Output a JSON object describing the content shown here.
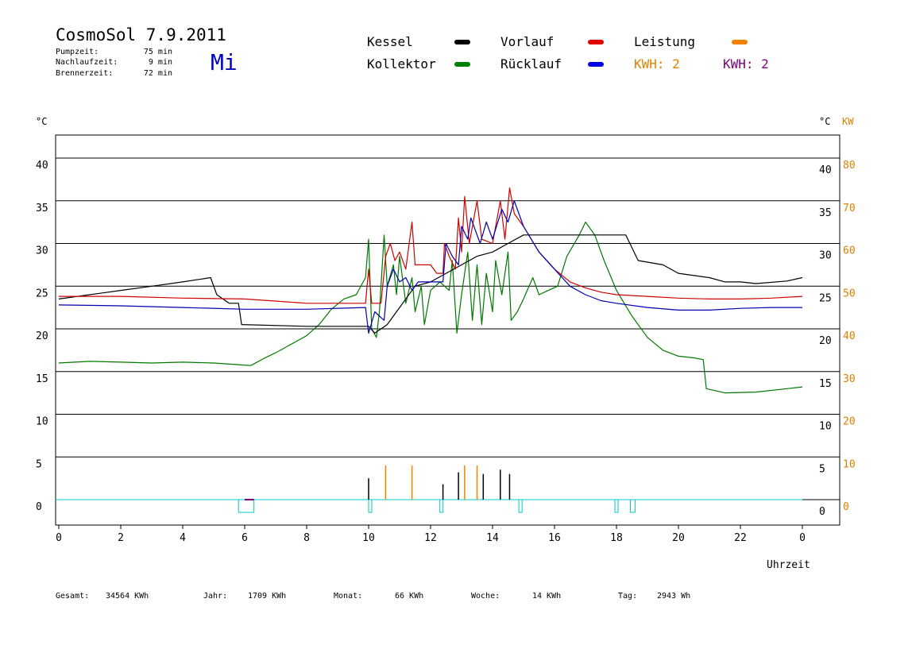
{
  "header": {
    "title": "CosmoSol 7.9.2011",
    "weekday": "Mi",
    "stats": [
      {
        "label": "Pumpzeit:",
        "value": "75 min"
      },
      {
        "label": "Nachlaufzeit:",
        "value": "9 min"
      },
      {
        "label": "Brennerzeit:",
        "value": "72 min"
      }
    ]
  },
  "legend": {
    "items": [
      {
        "label": "Kessel",
        "color": "#000000"
      },
      {
        "label": "Vorlauf",
        "color": "#e00000"
      },
      {
        "label": "Leistung",
        "color": "#f08000"
      },
      {
        "label": "Kollektor",
        "color": "#008000"
      },
      {
        "label": "Rücklauf",
        "color": "#0000e0"
      }
    ],
    "kwh_orange": "KWH: 2",
    "kwh_purple": "KWH: 2",
    "kwh_orange_color": "#e08000",
    "kwh_purple_color": "#800080"
  },
  "axes": {
    "left_unit": "°C",
    "right_unit": "°C",
    "right_unit2": "KW",
    "xlabel": "Uhrzeit"
  },
  "footer": [
    {
      "label": "Gesamt:",
      "value": "34564 KWh"
    },
    {
      "label": "Jahr:",
      "value": "1709 KWh"
    },
    {
      "label": "Monat:",
      "value": "66 KWh"
    },
    {
      "label": "Woche:",
      "value": "14 KWh"
    },
    {
      "label": "Tag:",
      "value": "2943 Wh"
    }
  ],
  "chart_data": {
    "type": "line",
    "xlim": [
      0,
      24
    ],
    "ylim": [
      -3,
      43
    ],
    "y2lim": [
      -6,
      86
    ],
    "grid": true,
    "x_ticks": [
      {
        "v": 0,
        "label": "0"
      },
      {
        "v": 2,
        "label": "2"
      },
      {
        "v": 4,
        "label": "4"
      },
      {
        "v": 6,
        "label": "6"
      },
      {
        "v": 8,
        "label": "8"
      },
      {
        "v": 10,
        "label": "10"
      },
      {
        "v": 12,
        "label": "12"
      },
      {
        "v": 14,
        "label": "14"
      },
      {
        "v": 16,
        "label": "16"
      },
      {
        "v": 18,
        "label": "18"
      },
      {
        "v": 20,
        "label": "20"
      },
      {
        "v": 22,
        "label": "22"
      },
      {
        "v": 24,
        "label": "0"
      }
    ],
    "y_ticks": [
      0,
      5,
      10,
      15,
      20,
      25,
      30,
      35,
      40
    ],
    "y2_ticks": [
      0,
      10,
      20,
      30,
      40,
      50,
      60,
      70,
      80
    ],
    "series": [
      {
        "name": "Kollektor",
        "color": "#007800",
        "points": [
          [
            0,
            16.0
          ],
          [
            1,
            16.2
          ],
          [
            2,
            16.1
          ],
          [
            3,
            16.0
          ],
          [
            4,
            16.1
          ],
          [
            5,
            16.0
          ],
          [
            5.8,
            15.8
          ],
          [
            6.2,
            15.7
          ],
          [
            6.6,
            16.5
          ],
          [
            7,
            17.2
          ],
          [
            7.5,
            18.2
          ],
          [
            8,
            19.2
          ],
          [
            8.4,
            20.5
          ],
          [
            8.8,
            22.3
          ],
          [
            9.2,
            23.5
          ],
          [
            9.6,
            24.0
          ],
          [
            9.9,
            26.0
          ],
          [
            10.0,
            30.5
          ],
          [
            10.1,
            20.0
          ],
          [
            10.25,
            19.0
          ],
          [
            10.35,
            22.0
          ],
          [
            10.5,
            31.0
          ],
          [
            10.6,
            25.0
          ],
          [
            10.8,
            27.5
          ],
          [
            10.9,
            24.0
          ],
          [
            11.0,
            28.5
          ],
          [
            11.2,
            23.0
          ],
          [
            11.4,
            26.0
          ],
          [
            11.5,
            22.0
          ],
          [
            11.7,
            25.0
          ],
          [
            11.8,
            20.5
          ],
          [
            12.0,
            24.5
          ],
          [
            12.3,
            25.5
          ],
          [
            12.6,
            24.5
          ],
          [
            12.7,
            28.0
          ],
          [
            12.85,
            19.5
          ],
          [
            13.0,
            24.0
          ],
          [
            13.2,
            29.0
          ],
          [
            13.35,
            21.0
          ],
          [
            13.5,
            27.5
          ],
          [
            13.65,
            20.5
          ],
          [
            13.8,
            26.5
          ],
          [
            14.0,
            22.0
          ],
          [
            14.1,
            28.0
          ],
          [
            14.3,
            24.0
          ],
          [
            14.5,
            29.0
          ],
          [
            14.6,
            21.0
          ],
          [
            14.8,
            22.0
          ],
          [
            15.0,
            23.5
          ],
          [
            15.3,
            26.0
          ],
          [
            15.5,
            24.0
          ],
          [
            15.8,
            24.5
          ],
          [
            16.1,
            25.0
          ],
          [
            16.4,
            28.5
          ],
          [
            16.8,
            31.0
          ],
          [
            17.0,
            32.5
          ],
          [
            17.3,
            31.0
          ],
          [
            17.6,
            28.0
          ],
          [
            18.0,
            24.5
          ],
          [
            18.5,
            21.5
          ],
          [
            19.0,
            19.0
          ],
          [
            19.5,
            17.5
          ],
          [
            20.0,
            16.8
          ],
          [
            20.5,
            16.6
          ],
          [
            20.8,
            16.4
          ],
          [
            20.9,
            13.0
          ],
          [
            21.5,
            12.5
          ],
          [
            22.5,
            12.6
          ],
          [
            23.5,
            13.0
          ],
          [
            24,
            13.2
          ]
        ]
      },
      {
        "name": "Kessel",
        "color": "#000000",
        "points": [
          [
            0,
            23.5
          ],
          [
            1,
            24.0
          ],
          [
            2,
            24.5
          ],
          [
            3,
            25.0
          ],
          [
            4,
            25.5
          ],
          [
            4.9,
            26.0
          ],
          [
            5.1,
            24.0
          ],
          [
            5.5,
            23.0
          ],
          [
            5.8,
            23.0
          ],
          [
            5.9,
            20.5
          ],
          [
            8,
            20.3
          ],
          [
            10.0,
            20.3
          ],
          [
            10.2,
            19.5
          ],
          [
            10.6,
            20.5
          ],
          [
            11,
            22.5
          ],
          [
            11.5,
            25.0
          ],
          [
            12,
            25.5
          ],
          [
            12.5,
            26.5
          ],
          [
            13,
            27.5
          ],
          [
            13.5,
            28.5
          ],
          [
            14,
            29.0
          ],
          [
            14.5,
            30.0
          ],
          [
            15,
            31.0
          ],
          [
            16,
            31.0
          ],
          [
            17,
            31.0
          ],
          [
            18.3,
            31.0
          ],
          [
            18.5,
            29.5
          ],
          [
            18.7,
            28.0
          ],
          [
            19.5,
            27.5
          ],
          [
            20.0,
            26.5
          ],
          [
            21,
            26.0
          ],
          [
            21.5,
            25.5
          ],
          [
            22,
            25.5
          ],
          [
            22.5,
            25.3
          ],
          [
            23.5,
            25.6
          ],
          [
            24,
            26.0
          ]
        ]
      },
      {
        "name": "Vorlauf",
        "color": "#d00000",
        "points": [
          [
            0,
            23.8
          ],
          [
            2,
            23.8
          ],
          [
            4,
            23.6
          ],
          [
            6,
            23.5
          ],
          [
            8,
            23.0
          ],
          [
            9.9,
            23.0
          ],
          [
            10.0,
            27.0
          ],
          [
            10.1,
            23.0
          ],
          [
            10.4,
            23.0
          ],
          [
            10.55,
            28.5
          ],
          [
            10.7,
            30.0
          ],
          [
            10.85,
            28.0
          ],
          [
            11.0,
            29.0
          ],
          [
            11.2,
            27.0
          ],
          [
            11.4,
            32.5
          ],
          [
            11.5,
            27.5
          ],
          [
            12.0,
            27.5
          ],
          [
            12.2,
            26.5
          ],
          [
            12.4,
            26.5
          ],
          [
            12.45,
            30.0
          ],
          [
            12.6,
            28.5
          ],
          [
            12.8,
            27.0
          ],
          [
            12.9,
            33.0
          ],
          [
            13.0,
            29.0
          ],
          [
            13.1,
            35.5
          ],
          [
            13.25,
            30.0
          ],
          [
            13.5,
            35.0
          ],
          [
            13.65,
            30.5
          ],
          [
            14.0,
            30.0
          ],
          [
            14.25,
            35.0
          ],
          [
            14.4,
            30.5
          ],
          [
            14.55,
            36.5
          ],
          [
            14.7,
            33.5
          ],
          [
            15.0,
            32.0
          ],
          [
            15.5,
            29.0
          ],
          [
            16.0,
            27.0
          ],
          [
            16.5,
            25.5
          ],
          [
            17,
            24.8
          ],
          [
            17.5,
            24.3
          ],
          [
            18,
            24.0
          ],
          [
            19,
            23.8
          ],
          [
            20,
            23.6
          ],
          [
            21,
            23.5
          ],
          [
            22,
            23.5
          ],
          [
            23,
            23.6
          ],
          [
            24,
            23.8
          ]
        ]
      },
      {
        "name": "Rücklauf",
        "color": "#0000b0",
        "points": [
          [
            0,
            22.8
          ],
          [
            2,
            22.7
          ],
          [
            4,
            22.5
          ],
          [
            6,
            22.3
          ],
          [
            8,
            22.3
          ],
          [
            9.9,
            22.5
          ],
          [
            10.0,
            19.5
          ],
          [
            10.2,
            22.0
          ],
          [
            10.5,
            21.0
          ],
          [
            10.6,
            25.0
          ],
          [
            10.8,
            27.0
          ],
          [
            11.0,
            25.5
          ],
          [
            11.2,
            26.0
          ],
          [
            11.4,
            24.5
          ],
          [
            11.6,
            25.5
          ],
          [
            12.0,
            25.5
          ],
          [
            12.4,
            25.5
          ],
          [
            12.5,
            30.0
          ],
          [
            12.7,
            28.5
          ],
          [
            12.9,
            27.5
          ],
          [
            13.0,
            32.0
          ],
          [
            13.2,
            30.5
          ],
          [
            13.3,
            33.0
          ],
          [
            13.6,
            30.0
          ],
          [
            13.8,
            32.5
          ],
          [
            14.0,
            30.5
          ],
          [
            14.3,
            34.0
          ],
          [
            14.5,
            32.5
          ],
          [
            14.7,
            35.0
          ],
          [
            15.0,
            32.0
          ],
          [
            15.5,
            29.0
          ],
          [
            16,
            27.0
          ],
          [
            16.5,
            25.0
          ],
          [
            17,
            24.0
          ],
          [
            17.5,
            23.3
          ],
          [
            18,
            23.0
          ],
          [
            19,
            22.5
          ],
          [
            20,
            22.2
          ],
          [
            21,
            22.2
          ],
          [
            22,
            22.4
          ],
          [
            23,
            22.5
          ],
          [
            24,
            22.5
          ]
        ]
      }
    ],
    "pump_bars": [
      {
        "start": 5.8,
        "end": 6.3,
        "color": "#00c8c8"
      },
      {
        "start": 10.0,
        "end": 10.1,
        "color": "#00c8c8"
      },
      {
        "start": 12.3,
        "end": 12.4,
        "color": "#00c8c8"
      },
      {
        "start": 14.85,
        "end": 14.95,
        "color": "#00c8c8"
      },
      {
        "start": 17.95,
        "end": 18.05,
        "color": "#00c8c8"
      },
      {
        "start": 18.45,
        "end": 18.6,
        "color": "#00c8c8"
      }
    ],
    "burner_bars": [
      {
        "start": 6.0,
        "end": 6.3,
        "color": "#800080"
      }
    ],
    "power_spikes": [
      {
        "x": 10.0,
        "h": 2.5,
        "color": "#000000"
      },
      {
        "x": 10.55,
        "h": 4.0,
        "color": "#f08000"
      },
      {
        "x": 11.4,
        "h": 4.0,
        "color": "#f08000"
      },
      {
        "x": 12.4,
        "h": 1.8,
        "color": "#000000"
      },
      {
        "x": 12.9,
        "h": 3.2,
        "color": "#000000"
      },
      {
        "x": 13.1,
        "h": 4.0,
        "color": "#f08000"
      },
      {
        "x": 13.5,
        "h": 4.0,
        "color": "#f08000"
      },
      {
        "x": 13.7,
        "h": 3.0,
        "color": "#000000"
      },
      {
        "x": 14.25,
        "h": 3.5,
        "color": "#000000"
      },
      {
        "x": 14.55,
        "h": 3.0,
        "color": "#000000"
      }
    ]
  }
}
